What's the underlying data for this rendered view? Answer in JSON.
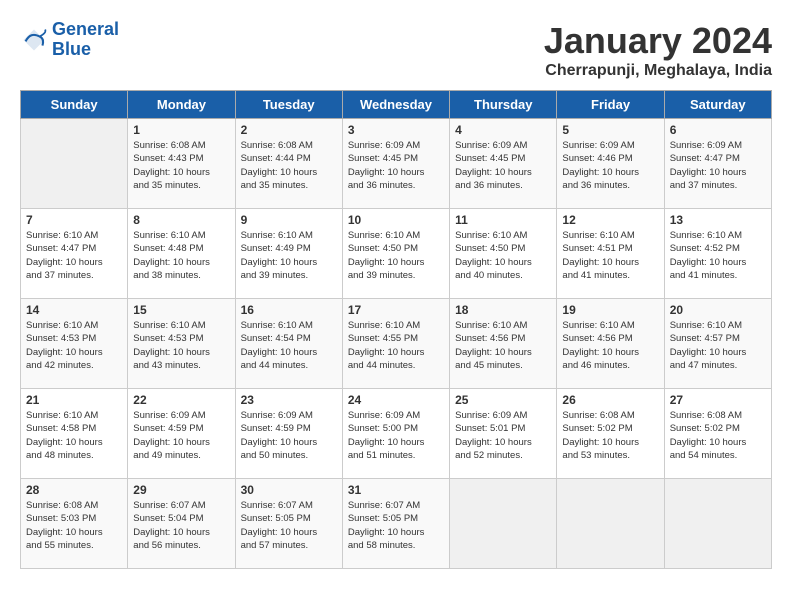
{
  "header": {
    "logo_line1": "General",
    "logo_line2": "Blue",
    "month": "January 2024",
    "location": "Cherrapunji, Meghalaya, India"
  },
  "days_of_week": [
    "Sunday",
    "Monday",
    "Tuesday",
    "Wednesday",
    "Thursday",
    "Friday",
    "Saturday"
  ],
  "weeks": [
    [
      {
        "day": "",
        "info": ""
      },
      {
        "day": "1",
        "info": "Sunrise: 6:08 AM\nSunset: 4:43 PM\nDaylight: 10 hours\nand 35 minutes."
      },
      {
        "day": "2",
        "info": "Sunrise: 6:08 AM\nSunset: 4:44 PM\nDaylight: 10 hours\nand 35 minutes."
      },
      {
        "day": "3",
        "info": "Sunrise: 6:09 AM\nSunset: 4:45 PM\nDaylight: 10 hours\nand 36 minutes."
      },
      {
        "day": "4",
        "info": "Sunrise: 6:09 AM\nSunset: 4:45 PM\nDaylight: 10 hours\nand 36 minutes."
      },
      {
        "day": "5",
        "info": "Sunrise: 6:09 AM\nSunset: 4:46 PM\nDaylight: 10 hours\nand 36 minutes."
      },
      {
        "day": "6",
        "info": "Sunrise: 6:09 AM\nSunset: 4:47 PM\nDaylight: 10 hours\nand 37 minutes."
      }
    ],
    [
      {
        "day": "7",
        "info": "Sunrise: 6:10 AM\nSunset: 4:47 PM\nDaylight: 10 hours\nand 37 minutes."
      },
      {
        "day": "8",
        "info": "Sunrise: 6:10 AM\nSunset: 4:48 PM\nDaylight: 10 hours\nand 38 minutes."
      },
      {
        "day": "9",
        "info": "Sunrise: 6:10 AM\nSunset: 4:49 PM\nDaylight: 10 hours\nand 39 minutes."
      },
      {
        "day": "10",
        "info": "Sunrise: 6:10 AM\nSunset: 4:50 PM\nDaylight: 10 hours\nand 39 minutes."
      },
      {
        "day": "11",
        "info": "Sunrise: 6:10 AM\nSunset: 4:50 PM\nDaylight: 10 hours\nand 40 minutes."
      },
      {
        "day": "12",
        "info": "Sunrise: 6:10 AM\nSunset: 4:51 PM\nDaylight: 10 hours\nand 41 minutes."
      },
      {
        "day": "13",
        "info": "Sunrise: 6:10 AM\nSunset: 4:52 PM\nDaylight: 10 hours\nand 41 minutes."
      }
    ],
    [
      {
        "day": "14",
        "info": "Sunrise: 6:10 AM\nSunset: 4:53 PM\nDaylight: 10 hours\nand 42 minutes."
      },
      {
        "day": "15",
        "info": "Sunrise: 6:10 AM\nSunset: 4:53 PM\nDaylight: 10 hours\nand 43 minutes."
      },
      {
        "day": "16",
        "info": "Sunrise: 6:10 AM\nSunset: 4:54 PM\nDaylight: 10 hours\nand 44 minutes."
      },
      {
        "day": "17",
        "info": "Sunrise: 6:10 AM\nSunset: 4:55 PM\nDaylight: 10 hours\nand 44 minutes."
      },
      {
        "day": "18",
        "info": "Sunrise: 6:10 AM\nSunset: 4:56 PM\nDaylight: 10 hours\nand 45 minutes."
      },
      {
        "day": "19",
        "info": "Sunrise: 6:10 AM\nSunset: 4:56 PM\nDaylight: 10 hours\nand 46 minutes."
      },
      {
        "day": "20",
        "info": "Sunrise: 6:10 AM\nSunset: 4:57 PM\nDaylight: 10 hours\nand 47 minutes."
      }
    ],
    [
      {
        "day": "21",
        "info": "Sunrise: 6:10 AM\nSunset: 4:58 PM\nDaylight: 10 hours\nand 48 minutes."
      },
      {
        "day": "22",
        "info": "Sunrise: 6:09 AM\nSunset: 4:59 PM\nDaylight: 10 hours\nand 49 minutes."
      },
      {
        "day": "23",
        "info": "Sunrise: 6:09 AM\nSunset: 4:59 PM\nDaylight: 10 hours\nand 50 minutes."
      },
      {
        "day": "24",
        "info": "Sunrise: 6:09 AM\nSunset: 5:00 PM\nDaylight: 10 hours\nand 51 minutes."
      },
      {
        "day": "25",
        "info": "Sunrise: 6:09 AM\nSunset: 5:01 PM\nDaylight: 10 hours\nand 52 minutes."
      },
      {
        "day": "26",
        "info": "Sunrise: 6:08 AM\nSunset: 5:02 PM\nDaylight: 10 hours\nand 53 minutes."
      },
      {
        "day": "27",
        "info": "Sunrise: 6:08 AM\nSunset: 5:02 PM\nDaylight: 10 hours\nand 54 minutes."
      }
    ],
    [
      {
        "day": "28",
        "info": "Sunrise: 6:08 AM\nSunset: 5:03 PM\nDaylight: 10 hours\nand 55 minutes."
      },
      {
        "day": "29",
        "info": "Sunrise: 6:07 AM\nSunset: 5:04 PM\nDaylight: 10 hours\nand 56 minutes."
      },
      {
        "day": "30",
        "info": "Sunrise: 6:07 AM\nSunset: 5:05 PM\nDaylight: 10 hours\nand 57 minutes."
      },
      {
        "day": "31",
        "info": "Sunrise: 6:07 AM\nSunset: 5:05 PM\nDaylight: 10 hours\nand 58 minutes."
      },
      {
        "day": "",
        "info": ""
      },
      {
        "day": "",
        "info": ""
      },
      {
        "day": "",
        "info": ""
      }
    ]
  ]
}
